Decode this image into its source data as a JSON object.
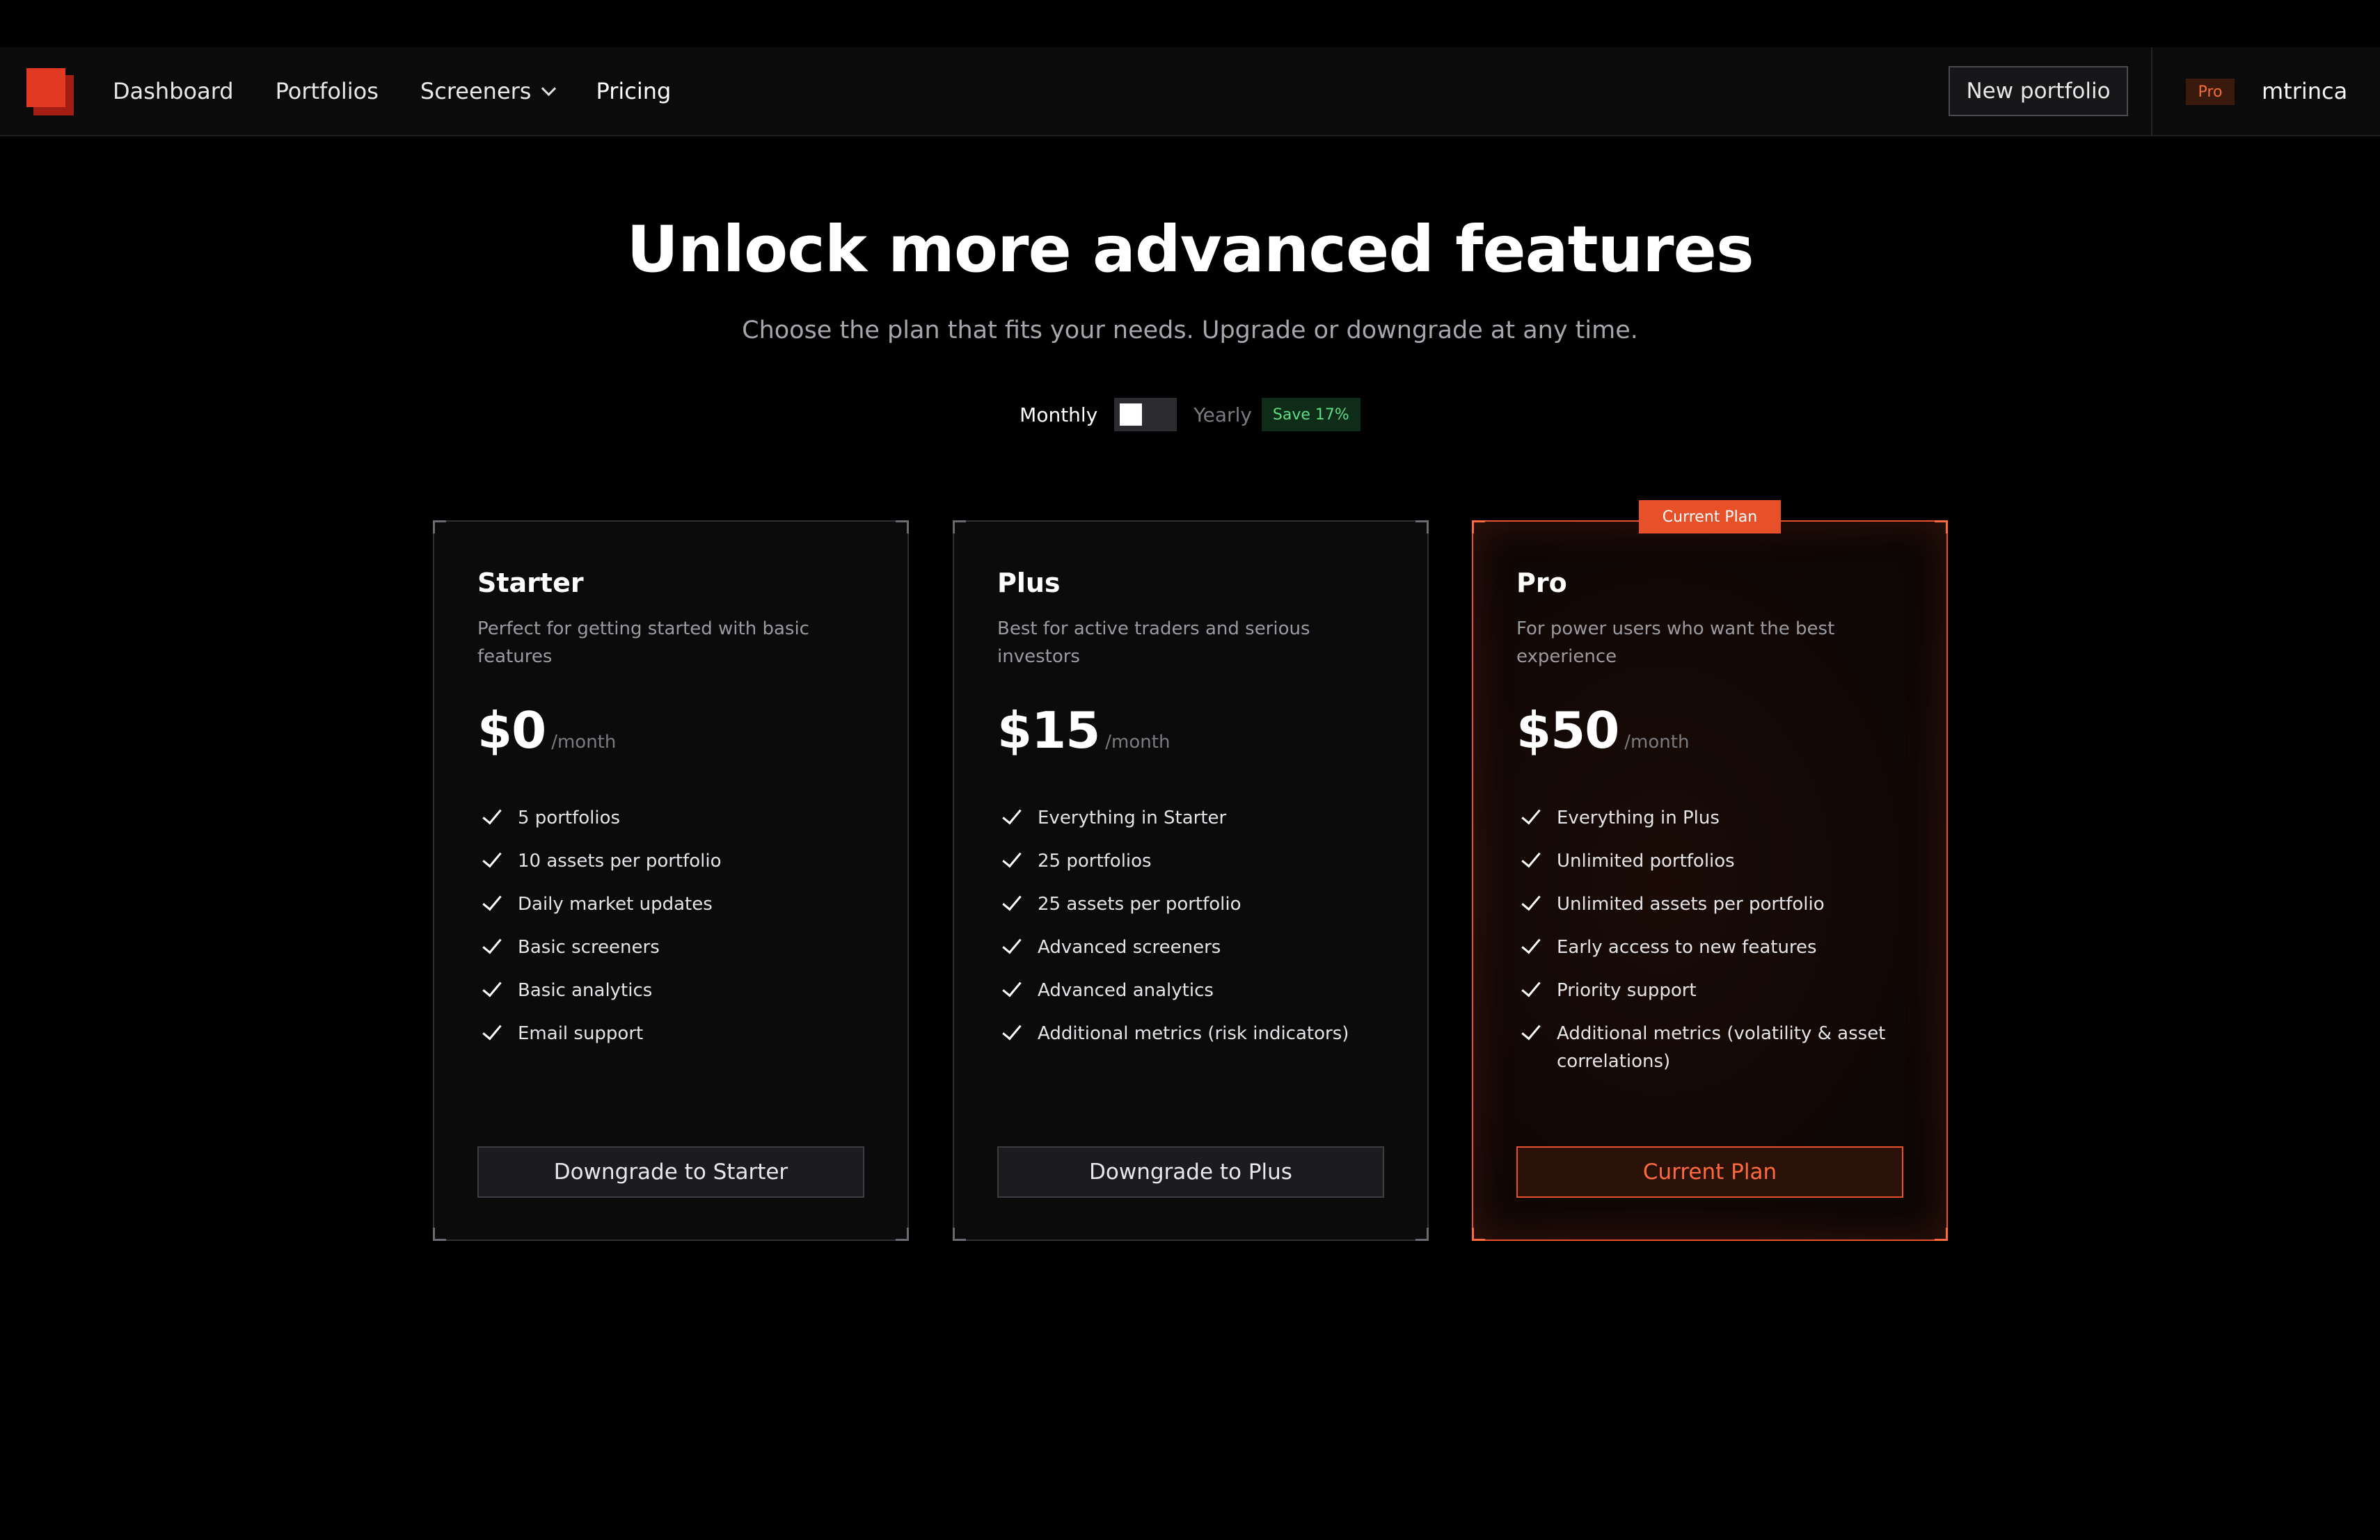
{
  "nav": {
    "links": [
      "Dashboard",
      "Portfolios",
      "Screeners",
      "Pricing"
    ],
    "new_portfolio": "New portfolio",
    "tier_badge": "Pro",
    "username": "mtrinca"
  },
  "hero": {
    "title": "Unlock more advanced features",
    "subtitle": "Choose the plan that fits your needs. Upgrade or downgrade at any time.",
    "toggle": {
      "monthly": "Monthly",
      "yearly": "Yearly",
      "save": "Save 17%",
      "selected": "Monthly"
    }
  },
  "plans": [
    {
      "name": "Starter",
      "description": "Perfect for getting started with basic features",
      "price": "$0",
      "period": "/month",
      "features": [
        "5 portfolios",
        "10 assets per portfolio",
        "Daily market updates",
        "Basic screeners",
        "Basic analytics",
        "Email support"
      ],
      "button": "Downgrade to Starter"
    },
    {
      "name": "Plus",
      "description": "Best for active traders and serious investors",
      "price": "$15",
      "period": "/month",
      "features": [
        "Everything in Starter",
        "25 portfolios",
        "25 assets per portfolio",
        "Advanced screeners",
        "Advanced analytics",
        "Additional metrics (risk indicators)"
      ],
      "button": "Downgrade to Plus"
    },
    {
      "name": "Pro",
      "description": "For power users who want the best experience",
      "price": "$50",
      "period": "/month",
      "features": [
        "Everything in Plus",
        "Unlimited portfolios",
        "Unlimited assets per portfolio",
        "Early access to new features",
        "Priority support",
        "Additional metrics (volatility & asset correlations)"
      ],
      "button": "Current Plan",
      "tag": "Current Plan"
    }
  ],
  "colors": {
    "accent": "#e8502a",
    "background": "#000000",
    "card": "#0b0b0c",
    "save_green": "#5fdc83"
  }
}
